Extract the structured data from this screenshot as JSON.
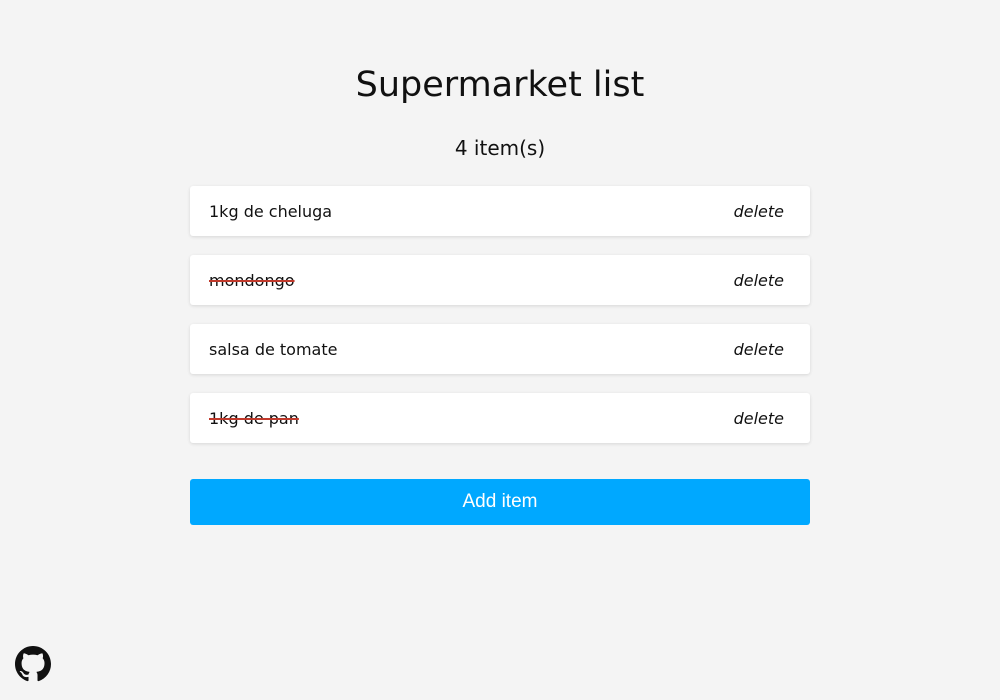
{
  "page": {
    "title": "Supermarket list",
    "count_label": "4 item(s)"
  },
  "items": [
    {
      "label": "1kg de cheluga",
      "done": false,
      "delete_label": "delete"
    },
    {
      "label": "mondongo",
      "done": true,
      "delete_label": "delete"
    },
    {
      "label": "salsa de tomate",
      "done": false,
      "delete_label": "delete"
    },
    {
      "label": "1kg de pan",
      "done": true,
      "delete_label": "delete"
    }
  ],
  "add_button": {
    "label": "Add item"
  },
  "icons": {
    "footer": "github-icon"
  },
  "colors": {
    "background": "#f4f4f4",
    "accent": "#00a8ff",
    "strike": "#c0392b"
  }
}
